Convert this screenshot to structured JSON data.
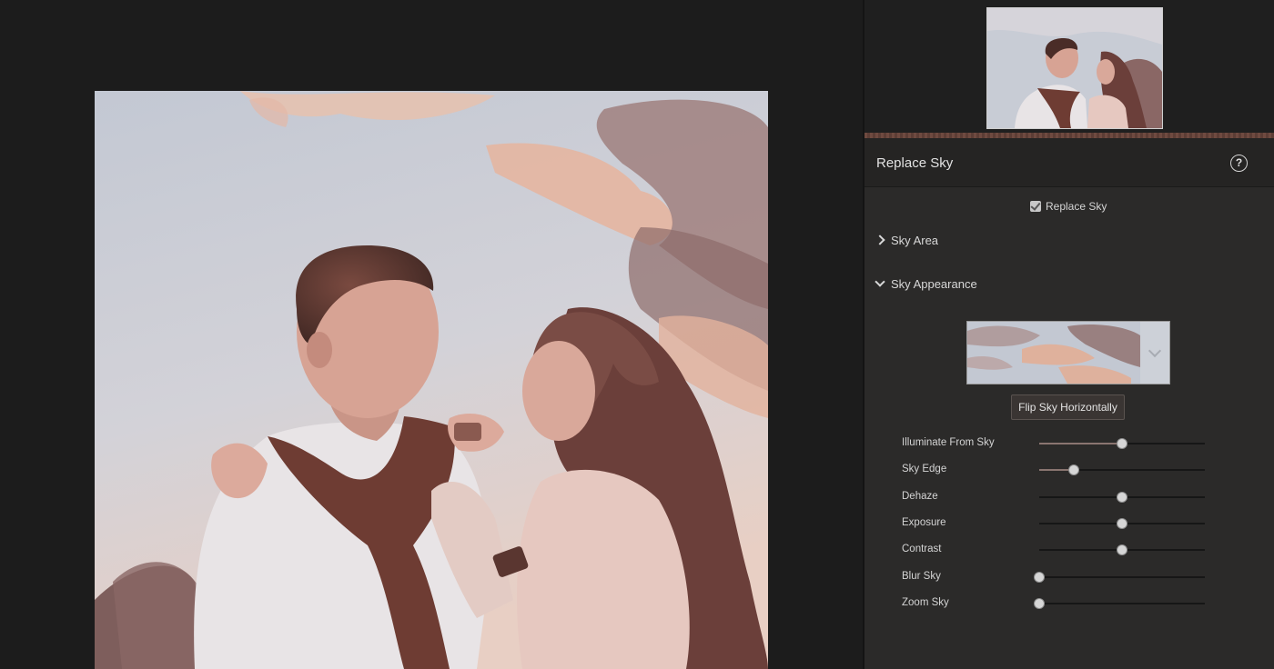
{
  "panel": {
    "title": "Replace Sky",
    "help_icon": "?",
    "replace_sky_label": "Replace Sky",
    "replace_sky_checked": true,
    "sections": {
      "sky_area": "Sky Area",
      "sky_appearance": "Sky Appearance"
    },
    "flip_button": "Flip Sky Horizontally",
    "sliders": [
      {
        "label": "Illuminate From Sky",
        "value": 0.5,
        "filled": true
      },
      {
        "label": "Sky Edge",
        "value": 0.21,
        "filled": true
      },
      {
        "label": "Dehaze",
        "value": 0.5,
        "filled": false
      },
      {
        "label": "Exposure",
        "value": 0.5,
        "filled": false
      },
      {
        "label": "Contrast",
        "value": 0.5,
        "filled": false
      },
      {
        "label": "Blur Sky",
        "value": 0.0,
        "filled": false
      },
      {
        "label": "Zoom Sky",
        "value": 0.0,
        "filled": false
      }
    ]
  },
  "colors": {
    "background": "#1b1b1b",
    "panel": "#2b2a29",
    "accent_divider": "#6f4a40"
  }
}
